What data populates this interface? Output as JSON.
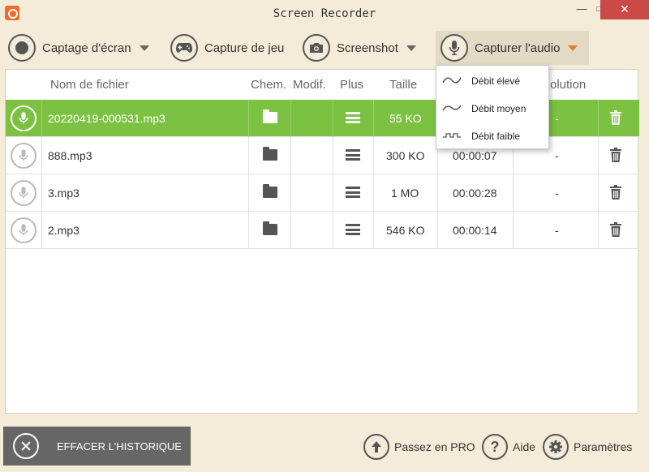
{
  "window": {
    "title": "Screen Recorder",
    "minimize": "—",
    "maximize": "□",
    "close": "✕"
  },
  "toolbar": {
    "items": [
      {
        "label": "Captage d'écran",
        "icon": "record-icon"
      },
      {
        "label": "Capture de jeu",
        "icon": "gamepad-icon"
      },
      {
        "label": "Screenshot",
        "icon": "camera-icon"
      },
      {
        "label": "Capturer l'audio",
        "icon": "microphone-icon"
      }
    ]
  },
  "table": {
    "headers": {
      "name": "Nom de fichier",
      "path": "Chem.",
      "modif": "Modif.",
      "more": "Plus",
      "size": "Taille",
      "resolution": "olution"
    },
    "rows": [
      {
        "name": "20220419-000531.mp3",
        "size": "55 KO",
        "duration": "",
        "resolution": "-"
      },
      {
        "name": "888.mp3",
        "size": "300 KO",
        "duration": "00:00:07",
        "resolution": "-"
      },
      {
        "name": "3.mp3",
        "size": "1 MO",
        "duration": "00:00:28",
        "resolution": "-"
      },
      {
        "name": "2.mp3",
        "size": "546 KO",
        "duration": "00:00:14",
        "resolution": "-"
      }
    ]
  },
  "dropdown": {
    "items": [
      "Débit élevé",
      "Débit moyen",
      "Débit faible"
    ]
  },
  "bottom": {
    "clear_history": "EFFACER L'HISTORIQUE",
    "pro": "Passez en PRO",
    "help": "Aide",
    "settings": "Paramètres"
  },
  "colors": {
    "accent_green": "#7dc142",
    "accent_orange": "#e8792c",
    "close_red": "#c94a46"
  }
}
